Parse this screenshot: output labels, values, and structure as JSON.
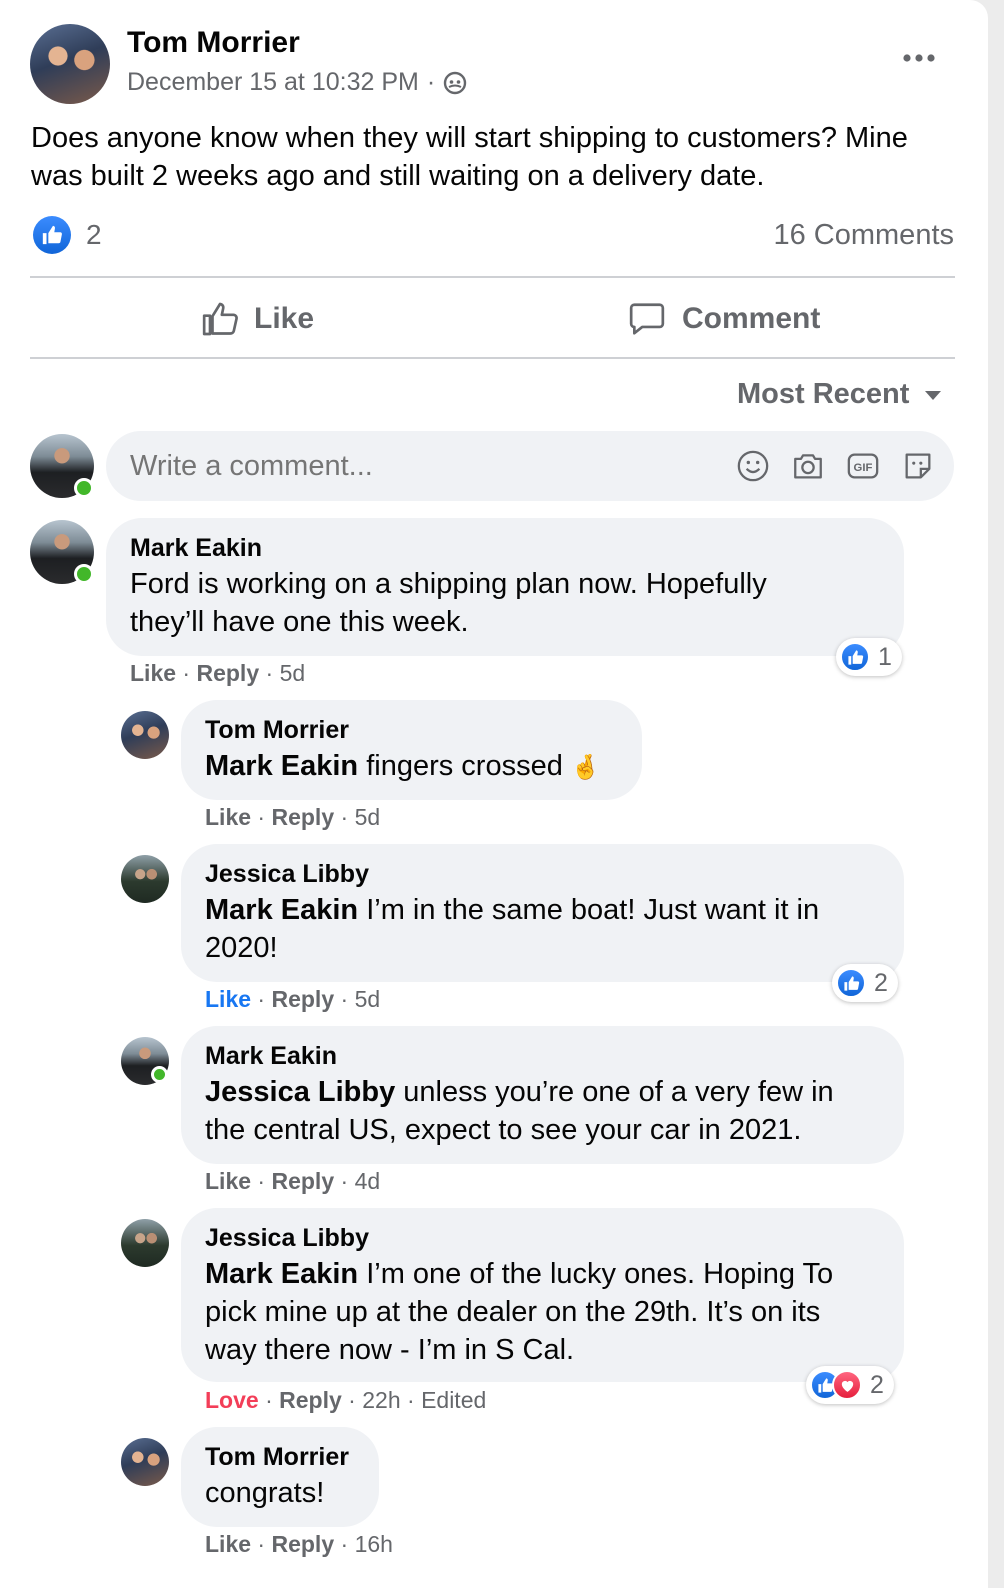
{
  "post": {
    "author": "Tom Morrier",
    "timestamp": "December 15 at 10:32 PM",
    "separator": "·",
    "text": "Does anyone know when they will start shipping to customers? Mine was built 2 weeks ago and still waiting on a delivery date.",
    "like_count": "2",
    "comments_count": "16 Comments"
  },
  "actions": {
    "like": "Like",
    "comment": "Comment"
  },
  "sort": {
    "label": "Most Recent"
  },
  "composer": {
    "placeholder": "Write a comment..."
  },
  "comments": [
    {
      "author": "Mark Eakin",
      "mention": "",
      "text": "Ford is working on a shipping plan now. Hopefully they’ll have one this week.",
      "action": "Like",
      "reply": "Reply",
      "time": "5d",
      "reactions": "1"
    },
    {
      "author": "Tom Morrier",
      "mention": "Mark Eakin",
      "text": "fingers crossed",
      "emoji": "🤞",
      "action": "Like",
      "reply": "Reply",
      "time": "5d"
    },
    {
      "author": "Jessica Libby",
      "mention": "Mark Eakin",
      "text": "I’m in the same boat! Just want it in 2020!",
      "action": "Like",
      "reply": "Reply",
      "time": "5d",
      "reactions": "2"
    },
    {
      "author": "Mark Eakin",
      "mention": "Jessica Libby",
      "text": "unless you’re one of a very few in the central US, expect to see your car in 2021.",
      "action": "Like",
      "reply": "Reply",
      "time": "4d"
    },
    {
      "author": "Jessica Libby",
      "mention": "Mark Eakin",
      "text": "I’m one of the lucky ones. Hoping To pick mine up at the dealer on the 29th. It’s on its way there now - I’m in S Cal.",
      "action": "Love",
      "reply": "Reply",
      "time": "22h",
      "edited": "Edited",
      "reactions": "2"
    },
    {
      "author": "Tom Morrier",
      "mention": "",
      "text": "congrats!",
      "action": "Like",
      "reply": "Reply",
      "time": "16h"
    }
  ],
  "colors": {
    "like_blue": "#1877f2",
    "love_red": "#f33e58",
    "bubble": "#f0f2f5",
    "muted": "#65676b",
    "online": "#42b72a"
  },
  "icons": [
    "more-icon",
    "globe-icon",
    "like-reaction-icon",
    "love-reaction-icon",
    "thumbs-up-icon",
    "comment-icon",
    "caret-down-icon",
    "emoji-icon",
    "camera-icon",
    "gif-icon",
    "sticker-icon"
  ]
}
